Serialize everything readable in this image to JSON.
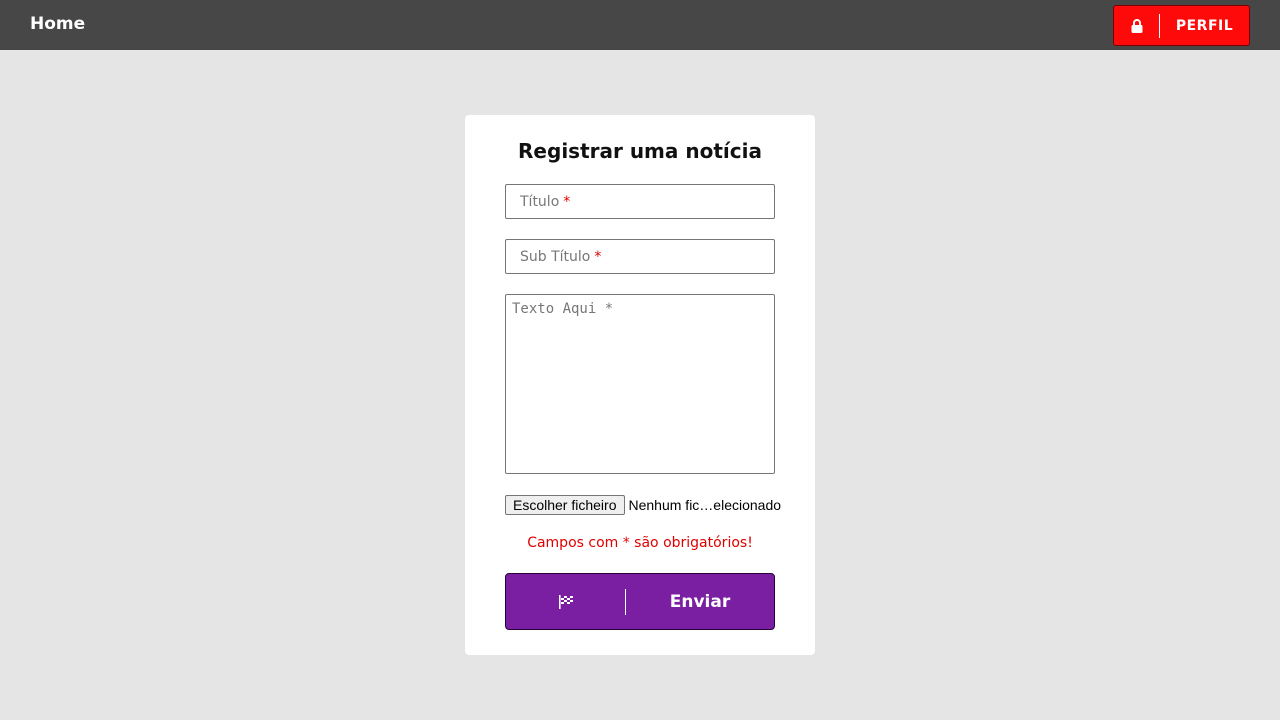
{
  "nav": {
    "home_label": "Home",
    "profile_label": "PERFIL",
    "profile_icon": "lock-icon"
  },
  "form": {
    "title": "Registrar uma notícia",
    "title_field": {
      "placeholder": "Título",
      "required_mark": "*"
    },
    "subtitle_field": {
      "placeholder": "Sub Título",
      "required_mark": "*"
    },
    "text_field": {
      "placeholder": "Texto Aqui *"
    },
    "file": {
      "button_label": "Escolher ficheiro",
      "status": "Nenhum fic…elecionado"
    },
    "required_note": "Campos com * são obrigatórios!",
    "submit": {
      "label": "Enviar",
      "icon": "checkered-flag-icon"
    }
  },
  "colors": {
    "topbar": "#474747",
    "profile_button": "#ff0a0a",
    "submit_button": "#7b1fa2",
    "required_text": "#e00000",
    "background": "#e5e5e5"
  }
}
